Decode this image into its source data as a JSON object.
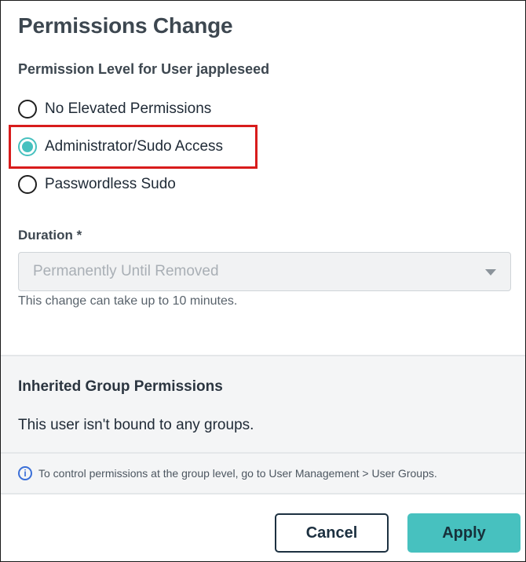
{
  "dialog": {
    "title": "Permissions Change",
    "permission_label": "Permission Level for User jappleseed",
    "options": [
      {
        "label": "No Elevated Permissions",
        "selected": false
      },
      {
        "label": "Administrator/Sudo Access",
        "selected": true
      },
      {
        "label": "Passwordless Sudo",
        "selected": false
      }
    ],
    "duration": {
      "label": "Duration *",
      "value": "Permanently Until Removed",
      "helper": "This change can take up to 10 minutes."
    },
    "inherited": {
      "title": "Inherited Group Permissions",
      "text": "This user isn't bound to any groups.",
      "info": "To control permissions at the group level, go to User Management > User Groups."
    },
    "buttons": {
      "cancel": "Cancel",
      "apply": "Apply"
    }
  },
  "colors": {
    "accent": "#47c1bf",
    "highlight": "#d81c1c",
    "info": "#3a6fd8"
  },
  "icons": {
    "info": "info-circle-icon",
    "caret": "chevron-down-icon"
  }
}
